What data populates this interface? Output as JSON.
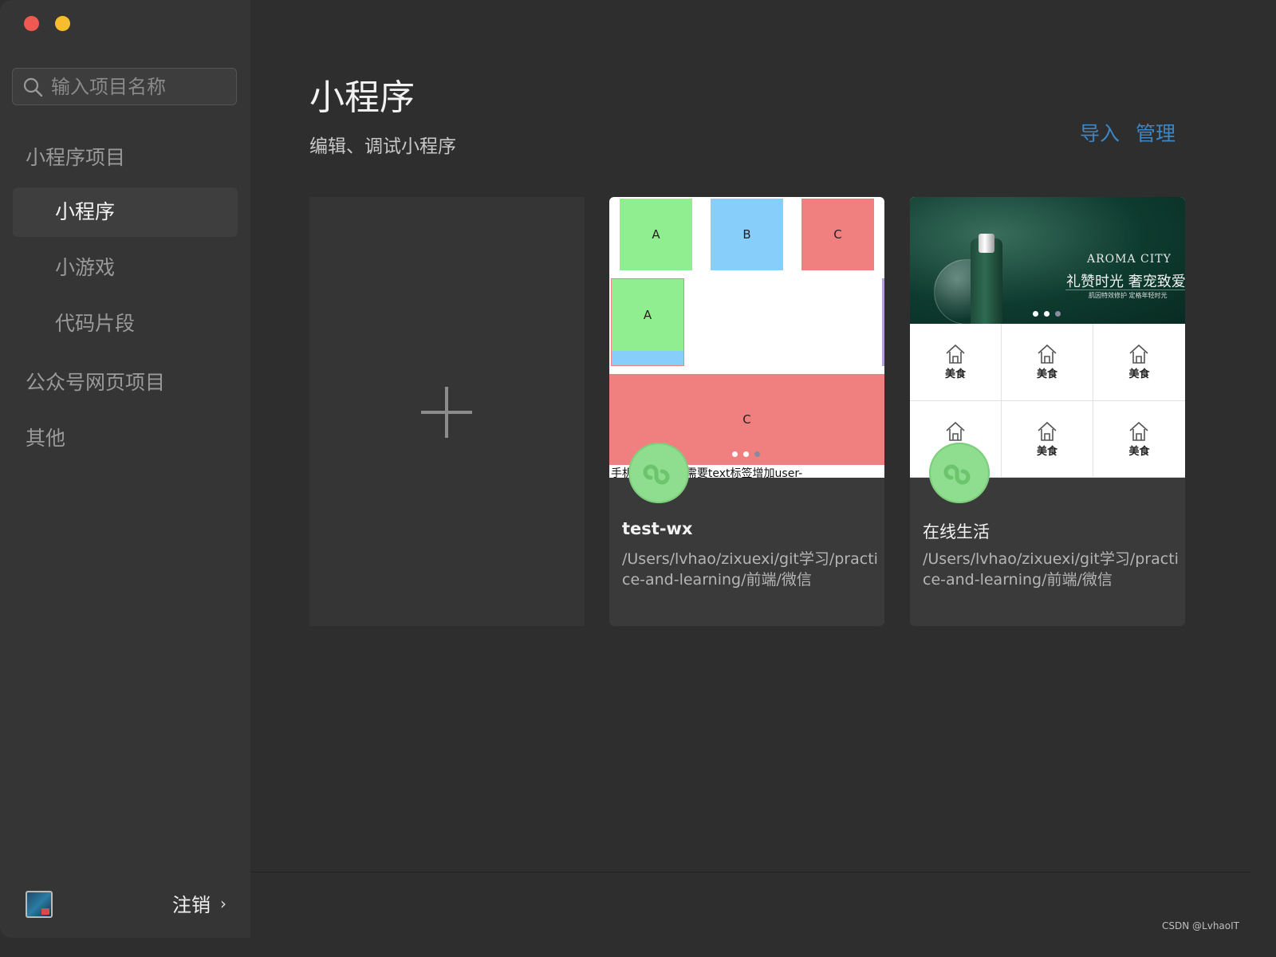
{
  "window": {
    "controls": [
      "close",
      "minimize"
    ]
  },
  "sidebar": {
    "search": {
      "placeholder": "输入项目名称",
      "value": ""
    },
    "sections": [
      {
        "label": "小程序项目",
        "items": [
          {
            "label": "小程序",
            "active": true
          },
          {
            "label": "小游戏",
            "active": false
          },
          {
            "label": "代码片段",
            "active": false
          }
        ]
      },
      {
        "label": "公众号网页项目"
      },
      {
        "label": "其他"
      }
    ],
    "footer": {
      "logout_label": "注销"
    }
  },
  "main": {
    "title": "小程序",
    "subtitle": "编辑、调试小程序",
    "actions": {
      "import_label": "导入",
      "manage_label": "管理"
    },
    "new_project_icon": "plus-icon",
    "projects": [
      {
        "name": "test-wx",
        "path": "/Users/lvhao/zixuexi/git学习/practice-and-learning/前端/微信",
        "thumbnail": {
          "blocks_top": [
            "A",
            "B",
            "C"
          ],
          "block_mid": "A",
          "block_big": "C",
          "caption": "手机      选中效果(需要text标签增加user-"
        }
      },
      {
        "name": "在线生活",
        "path": "/Users/lvhao/zixuexi/git学习/practice-and-learning/前端/微信",
        "thumbnail": {
          "brand": "AROMA CITY",
          "slogan": "礼赞时光 奢宠致爱",
          "subslogan": "肌因特效修护   定格年轻时光",
          "grid_labels": [
            "美食",
            "美食",
            "美食",
            "",
            "美食",
            "美食"
          ]
        }
      }
    ]
  },
  "watermark": "CSDN @LvhaoIT",
  "colors": {
    "accent_link": "#3e86c1",
    "mp_logo": "#8fde8f",
    "sidebar_bg": "#353535",
    "main_bg": "#2e2e2e"
  }
}
